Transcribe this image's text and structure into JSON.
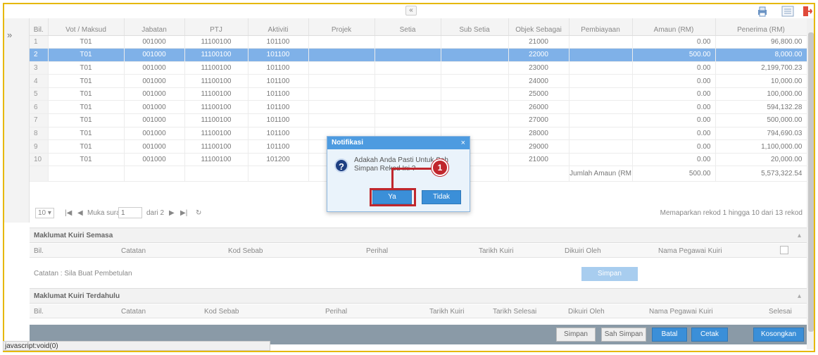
{
  "grid": {
    "headers": [
      "Bil.",
      "Vot / Maksud",
      "Jabatan",
      "PTJ",
      "Aktiviti",
      "Projek",
      "Setia",
      "Sub Setia",
      "Objek Sebagai",
      "Pembiayaan",
      "Amaun (RM)",
      "Penerima (RM)"
    ],
    "rows": [
      [
        "1",
        "T01",
        "001000",
        "11100100",
        "101100",
        "",
        "",
        "",
        "21000",
        "",
        "0.00",
        "96,800.00"
      ],
      [
        "2",
        "T01",
        "001000",
        "11100100",
        "101100",
        "",
        "",
        "",
        "22000",
        "",
        "500.00",
        "8,000.00"
      ],
      [
        "3",
        "T01",
        "001000",
        "11100100",
        "101100",
        "",
        "",
        "",
        "23000",
        "",
        "0.00",
        "2,199,700.23"
      ],
      [
        "4",
        "T01",
        "001000",
        "11100100",
        "101100",
        "",
        "",
        "",
        "24000",
        "",
        "0.00",
        "10,000.00"
      ],
      [
        "5",
        "T01",
        "001000",
        "11100100",
        "101100",
        "",
        "",
        "",
        "25000",
        "",
        "0.00",
        "100,000.00"
      ],
      [
        "6",
        "T01",
        "001000",
        "11100100",
        "101100",
        "",
        "",
        "",
        "26000",
        "",
        "0.00",
        "594,132.28"
      ],
      [
        "7",
        "T01",
        "001000",
        "11100100",
        "101100",
        "",
        "",
        "",
        "27000",
        "",
        "0.00",
        "500,000.00"
      ],
      [
        "8",
        "T01",
        "001000",
        "11100100",
        "101100",
        "",
        "",
        "",
        "28000",
        "",
        "0.00",
        "794,690.03"
      ],
      [
        "9",
        "T01",
        "001000",
        "11100100",
        "101100",
        "",
        "",
        "",
        "29000",
        "",
        "0.00",
        "1,100,000.00"
      ],
      [
        "10",
        "T01",
        "001000",
        "11100100",
        "101200",
        "",
        "",
        "",
        "21000",
        "",
        "0.00",
        "20,000.00"
      ]
    ],
    "selected_row": 2,
    "total_label": "Jumlah Amaun (RM",
    "total_amaun": "500.00",
    "total_penerima": "5,573,322.54"
  },
  "pager": {
    "page_size": "10",
    "page_label": "Muka surat",
    "page_value": "1",
    "of_label": "dari 2",
    "summary": "Memaparkan rekod 1 hingga 10 dari 13 rekod"
  },
  "kuiri_semasa": {
    "title": "Maklumat Kuiri Semasa",
    "headers": [
      "Bil.",
      "Catatan",
      "Kod Sebab",
      "Perihal",
      "Tarikh Kuiri",
      "Dikuiri Oleh",
      "Nama Pegawai Kuiri"
    ],
    "note": "Catatan : Sila Buat Pembetulan",
    "save_label": "Simpan"
  },
  "kuiri_terdahulu": {
    "title": "Maklumat Kuiri Terdahulu",
    "headers": [
      "Bil.",
      "Catatan",
      "Kod Sebab",
      "Perihal",
      "Tarikh Kuiri",
      "Tarikh Selesai",
      "Dikuiri Oleh",
      "Nama Pegawai Kuiri",
      "Selesai"
    ]
  },
  "footer_buttons": {
    "simpan": "Simpan",
    "sah_simpan": "Sah Simpan",
    "batal": "Batal",
    "cetak": "Cetak",
    "kosongkan": "Kosongkan"
  },
  "dialog": {
    "title": "Notifikasi",
    "message": "Adakah Anda Pasti Untuk Sah Simpan Rekod Ini ?",
    "yes_label": "Ya",
    "no_label": "Tidak",
    "close": "×"
  },
  "callout": {
    "number": "1"
  },
  "status_bar": "javascript:void(0)",
  "icons": {
    "collapse": "chevron-up-icon",
    "sidebar_toggle": "double-chevron-right-icon",
    "print": "printer-icon",
    "list": "list-icon",
    "logout": "logout-icon",
    "question": "question-icon"
  },
  "colors": {
    "selected_row": "#7fb1e8",
    "primary_button": "#3b8fd8",
    "callout": "#c0272d",
    "frame": "#e6b800"
  }
}
